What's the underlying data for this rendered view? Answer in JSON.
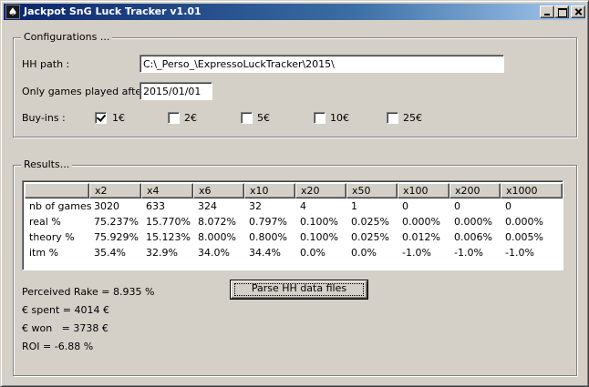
{
  "window": {
    "title": "Jackpot SnG Luck Tracker v1.01",
    "app_icon": "spade-card-icon",
    "app_icon_glyph": "♠"
  },
  "configurations": {
    "legend": "Configurations ...",
    "hh_path_label": "HH path :",
    "hh_path_value": "C:\\_Perso_\\ExpressoLuckTracker\\2015\\",
    "only_after_label": "Only games played after :",
    "only_after_value": "2015/01/01",
    "buyins_label": "Buy-ins :",
    "buyins": [
      {
        "label": "1€",
        "checked": true
      },
      {
        "label": "2€",
        "checked": false
      },
      {
        "label": "5€",
        "checked": false
      },
      {
        "label": "10€",
        "checked": false
      },
      {
        "label": "25€",
        "checked": false
      }
    ]
  },
  "results": {
    "legend": "Results...",
    "columns": [
      "",
      "x2",
      "x4",
      "x6",
      "x10",
      "x20",
      "x50",
      "x100",
      "x200",
      "x1000"
    ],
    "rows": [
      [
        "nb of games",
        "3020",
        "633",
        "324",
        "32",
        "4",
        "1",
        "0",
        "0",
        "0"
      ],
      [
        "real %",
        "75.237%",
        "15.770%",
        "8.072%",
        "0.797%",
        "0.100%",
        "0.025%",
        "0.000%",
        "0.000%",
        "0.000%"
      ],
      [
        "theory %",
        "75.929%",
        "15.123%",
        "8.000%",
        "0.800%",
        "0.100%",
        "0.025%",
        "0.012%",
        "0.006%",
        "0.005%"
      ],
      [
        "itm %",
        "35.4%",
        "32.9%",
        "34.0%",
        "34.4%",
        "0.0%",
        "0.0%",
        "-1.0%",
        "-1.0%",
        "-1.0%"
      ]
    ],
    "perceived_rake": "Perceived Rake = 8.935 %",
    "spent": "€ spent = 4014 €",
    "won": "€ won   = 3738 €",
    "roi": "ROI = -6.88 %",
    "parse_button_label": "Parse HH data files"
  }
}
